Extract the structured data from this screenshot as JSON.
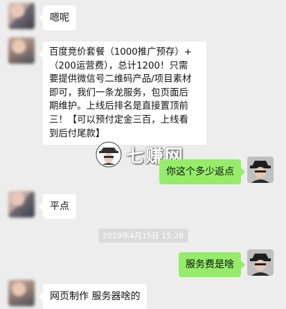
{
  "messages": [
    {
      "side": "left",
      "text": "嗯呢"
    },
    {
      "side": "left",
      "lines": [
        "百度竞价套餐（1000推广预存）+",
        "（200运营费），总计1200！只需",
        "要提供微信号二维码产品/项目素材",
        "即可，我们一条龙服务，包页面后",
        "期维护。上线后排名是直接置顶前",
        "三！【可以预付定金三百，上线看",
        "到后付尾款】"
      ]
    },
    {
      "side": "right",
      "text": "你这个多少返点"
    },
    {
      "side": "left",
      "text": "平点"
    },
    {
      "side": "right",
      "text": "服务费是啥"
    },
    {
      "side": "left",
      "text": "网页制作 服务器啥的"
    }
  ],
  "timestamp": "2019年4月15日 15:28",
  "watermark": "七赚网",
  "colors": {
    "background": "#ededed",
    "sent_bubble": "#95ec69",
    "received_bubble": "#ffffff"
  }
}
